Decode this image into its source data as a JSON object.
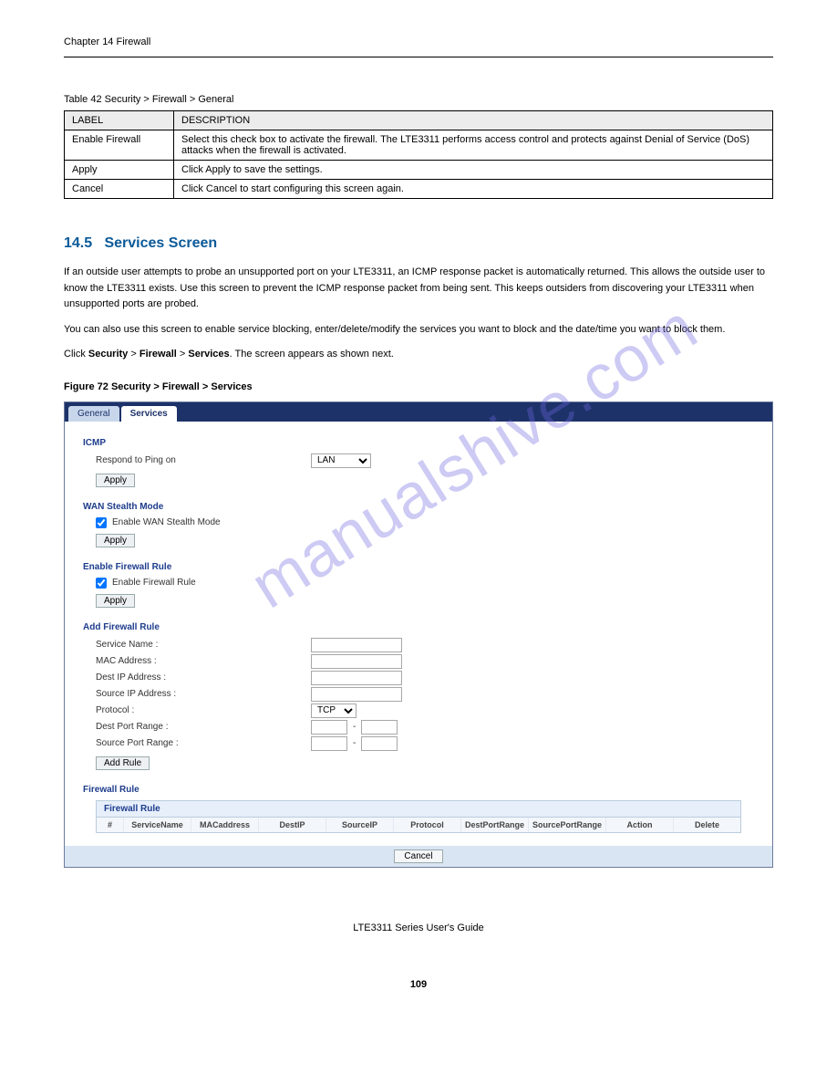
{
  "header": {
    "chapter_left": "Chapter 14 Firewall",
    "title_right": "LTE3311 Series User's Guide"
  },
  "table_intro": "Table 42   Security > Firewall > General",
  "ref_table": {
    "head_label": "LABEL",
    "head_desc": "DESCRIPTION",
    "rows": [
      {
        "label": "Enable Firewall",
        "desc": "Select this check box to activate the firewall. The LTE3311 performs access control and protects against Denial of Service (DoS) attacks when the firewall is activated."
      },
      {
        "label": "Apply",
        "desc": "Click Apply to save the settings."
      },
      {
        "label": "Cancel",
        "desc": "Click Cancel to start configuring this screen again."
      }
    ]
  },
  "section": {
    "number": "14.5",
    "title": "Services Screen",
    "p1_a": "If an outside user attempts to probe an unsupported port on your LTE3311, an ICMP response packet is automatically returned. This allows the outside user to know the LTE3311 exists. Use this screen to prevent the ICMP response packet from being sent. This keeps outsiders from discovering your LTE3311 when unsupported ports are probed.",
    "p1_b": "You can also use this screen to enable service blocking, enter/delete/modify the services you want to block and the date/time you want to block them.",
    "p2_a": "Click ",
    "p2_b": "Security",
    "p2_c": " > ",
    "p2_d": "Firewall",
    "p2_e": " > ",
    "p2_f": "Services",
    "p2_g": ". The screen appears as shown next."
  },
  "figure_caption": "Figure 72   Security > Firewall > Services",
  "ui": {
    "tabs": {
      "general": "General",
      "services": "Services"
    },
    "icmp": {
      "title": "ICMP",
      "ping_label": "Respond to Ping on",
      "ping_value": "LAN",
      "apply": "Apply"
    },
    "wan": {
      "title": "WAN Stealth Mode",
      "checkbox_label": "Enable WAN Stealth Mode",
      "apply": "Apply"
    },
    "enable_rule": {
      "title": "Enable Firewall Rule",
      "checkbox_label": "Enable Firewall Rule",
      "apply": "Apply"
    },
    "add_rule": {
      "title": "Add Firewall Rule",
      "service_name": "Service Name :",
      "mac": "MAC Address :",
      "dest_ip": "Dest IP Address :",
      "source_ip": "Source IP Address :",
      "protocol": "Protocol :",
      "protocol_value": "TCP",
      "dest_port": "Dest Port Range :",
      "source_port": "Source Port Range :",
      "add_btn": "Add Rule"
    },
    "rule_list": {
      "section_title": "Firewall Rule",
      "table_title": "Firewall Rule",
      "cols": {
        "num": "#",
        "service": "ServiceName",
        "mac": "MACaddress",
        "destip": "DestIP",
        "sourceip": "SourceIP",
        "protocol": "Protocol",
        "destport": "DestPortRange",
        "sourceport": "SourcePortRange",
        "action": "Action",
        "delete": "Delete"
      }
    },
    "cancel": "Cancel"
  },
  "watermark": "manualshive.com",
  "page_number": "109"
}
